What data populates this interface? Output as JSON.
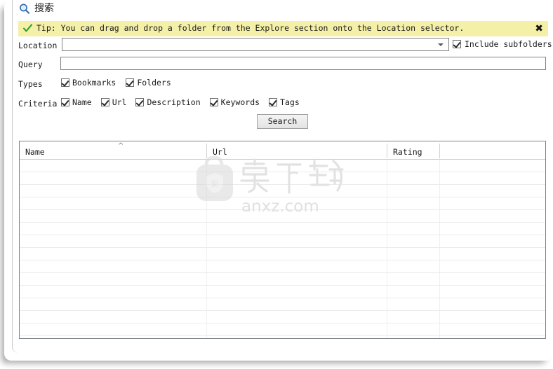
{
  "window": {
    "title": "搜索",
    "title_icon": "magnifier-icon"
  },
  "tip": {
    "icon": "green-check-icon",
    "text": "Tip: You can drag and drop a folder from the Explore section onto the Location selector.",
    "close_label": "✖",
    "background_color": "#f5f0a8"
  },
  "form": {
    "location": {
      "label": "Location",
      "value": "",
      "placeholder": "",
      "dropdown_icon": "chevron-down-icon"
    },
    "include_subfolders": {
      "label": "Include subfolders",
      "checked": true
    },
    "query": {
      "label": "Query",
      "value": "",
      "placeholder": ""
    },
    "types": {
      "label": "Types",
      "options": [
        {
          "label": "Bookmarks",
          "checked": true
        },
        {
          "label": "Folders",
          "checked": true
        }
      ]
    },
    "criteria": {
      "label": "Criteria",
      "options": [
        {
          "label": "Name",
          "checked": true
        },
        {
          "label": "Url",
          "checked": true
        },
        {
          "label": "Description",
          "checked": true
        },
        {
          "label": "Keywords",
          "checked": true
        },
        {
          "label": "Tags",
          "checked": true
        }
      ]
    },
    "search_button": "Search"
  },
  "results": {
    "columns": [
      {
        "label": "Name",
        "sort": "asc"
      },
      {
        "label": "Url",
        "sort": ""
      },
      {
        "label": "Rating",
        "sort": ""
      },
      {
        "label": "",
        "sort": ""
      }
    ],
    "rows": []
  },
  "watermark": {
    "text_cn": "安下载",
    "text_en": "anxz.com",
    "logo": "bag-shield-logo"
  }
}
